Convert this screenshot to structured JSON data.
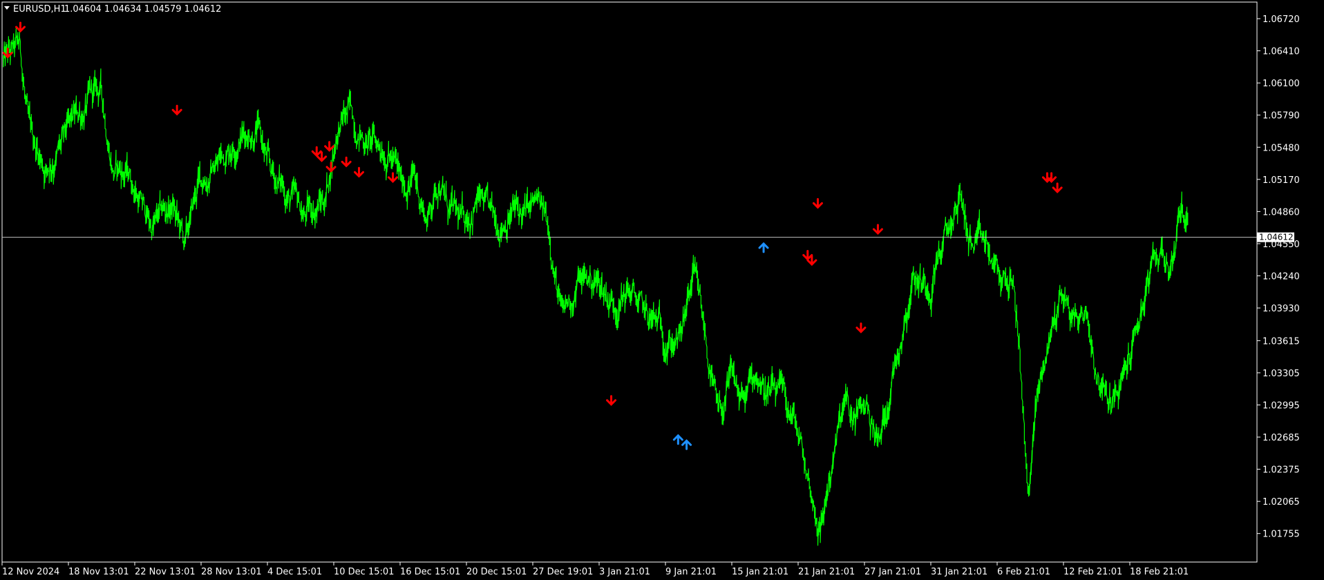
{
  "header": {
    "symbol": "EURUSD,H1",
    "ohlc": "1.04604 1.04634 1.04579 1.04612"
  },
  "colors": {
    "background": "#000000",
    "frame": "#ffffff",
    "price_line": "#00ff00",
    "bid_line": "#c0c0c0",
    "sell_arrow": "#ff0000",
    "buy_arrow": "#1e90ff"
  },
  "chart_data": {
    "type": "line",
    "title": "EURUSD,H1",
    "timeframe": "H1",
    "ylim": [
      1.0148,
      1.0688
    ],
    "y_ticks": [
      "1.06720",
      "1.06410",
      "1.06100",
      "1.05790",
      "1.05480",
      "1.05170",
      "1.04860",
      "1.04550",
      "1.04240",
      "1.03930",
      "1.03615",
      "1.03305",
      "1.02995",
      "1.02685",
      "1.02375",
      "1.02065",
      "1.01755"
    ],
    "x_ticks": [
      "12 Nov 2024",
      "18 Nov 13:01",
      "22 Nov 13:01",
      "28 Nov 13:01",
      "4 Dec 15:01",
      "10 Dec 15:01",
      "16 Dec 15:01",
      "20 Dec 15:01",
      "27 Dec 19:01",
      "3 Jan 21:01",
      "9 Jan 21:01",
      "15 Jan 21:01",
      "21 Jan 21:01",
      "27 Jan 21:01",
      "31 Jan 21:01",
      "6 Feb 21:01",
      "12 Feb 21:01",
      "18 Feb 21:01"
    ],
    "x_count": 1400,
    "bid_price": 1.04612,
    "bid_label": "1.04612",
    "series": [
      {
        "x": [
          0,
          20,
          30,
          50,
          70,
          100,
          115,
          130,
          150,
          175,
          200,
          215,
          230,
          250,
          275,
          300,
          315,
          330,
          355,
          380,
          395,
          410,
          425,
          440,
          455,
          470,
          485,
          500,
          515,
          525,
          540,
          560,
          580,
          600,
          615,
          630,
          645,
          660,
          680,
          700,
          720,
          740,
          760,
          780,
          800,
          815,
          830,
          845,
          860,
          875,
          890,
          905,
          920,
          935,
          950,
          965,
          980,
          995,
          1000,
          1012,
          1020,
          1035,
          1050,
          1065,
          1075,
          1085,
          1095,
          1105,
          1115,
          1130,
          1145,
          1160,
          1175,
          1190,
          1200,
          1210,
          1220,
          1235,
          1250,
          1265,
          1280,
          1290,
          1305,
          1320,
          1335,
          1350,
          1360,
          1370,
          1380,
          1390,
          1398
        ],
        "y": [
          1.063,
          1.064,
          1.056,
          1.053,
          1.055,
          1.059,
          1.06,
          1.053,
          1.052,
          1.047,
          1.049,
          1.045,
          1.051,
          1.053,
          1.056,
          1.057,
          1.052,
          1.051,
          1.048,
          1.05,
          1.057,
          1.058,
          1.056,
          1.055,
          1.055,
          1.051,
          1.052,
          1.048,
          1.052,
          1.049,
          1.047,
          1.05,
          1.047,
          1.049,
          1.048,
          1.049,
          1.047,
          1.038,
          1.042,
          1.042,
          1.04,
          1.041,
          1.038,
          1.037,
          1.036,
          1.042,
          1.036,
          1.028,
          1.032,
          1.03,
          1.033,
          1.031,
          1.03,
          1.028,
          1.023,
          1.018,
          1.025,
          1.03,
          1.028,
          1.029,
          1.03,
          1.026,
          1.033,
          1.039,
          1.043,
          1.042,
          1.042,
          1.045,
          1.046,
          1.05,
          1.045,
          1.045,
          1.042,
          1.042,
          1.036,
          1.021,
          1.03,
          1.036,
          1.041,
          1.038,
          1.039,
          1.034,
          1.03,
          1.031,
          1.036,
          1.041,
          1.043,
          1.045,
          1.043,
          1.049,
          1.048
        ]
      }
    ],
    "sell_signals": [
      {
        "x": 5,
        "y": 1.0635
      },
      {
        "x": 20,
        "y": 1.066
      },
      {
        "x": 205,
        "y": 1.058
      },
      {
        "x": 370,
        "y": 1.054
      },
      {
        "x": 376,
        "y": 1.0535
      },
      {
        "x": 385,
        "y": 1.0545
      },
      {
        "x": 387,
        "y": 1.0525
      },
      {
        "x": 405,
        "y": 1.053
      },
      {
        "x": 420,
        "y": 1.052
      },
      {
        "x": 460,
        "y": 1.0515
      },
      {
        "x": 718,
        "y": 1.03
      },
      {
        "x": 950,
        "y": 1.044
      },
      {
        "x": 955,
        "y": 1.0435
      },
      {
        "x": 962,
        "y": 1.049
      },
      {
        "x": 1013,
        "y": 1.037
      },
      {
        "x": 1033,
        "y": 1.0465
      },
      {
        "x": 1233,
        "y": 1.0515
      },
      {
        "x": 1238,
        "y": 1.0515
      },
      {
        "x": 1245,
        "y": 1.0505
      }
    ],
    "buy_signals": [
      {
        "x": 797,
        "y": 1.027
      },
      {
        "x": 807,
        "y": 1.0265
      },
      {
        "x": 898,
        "y": 1.0455
      }
    ]
  }
}
